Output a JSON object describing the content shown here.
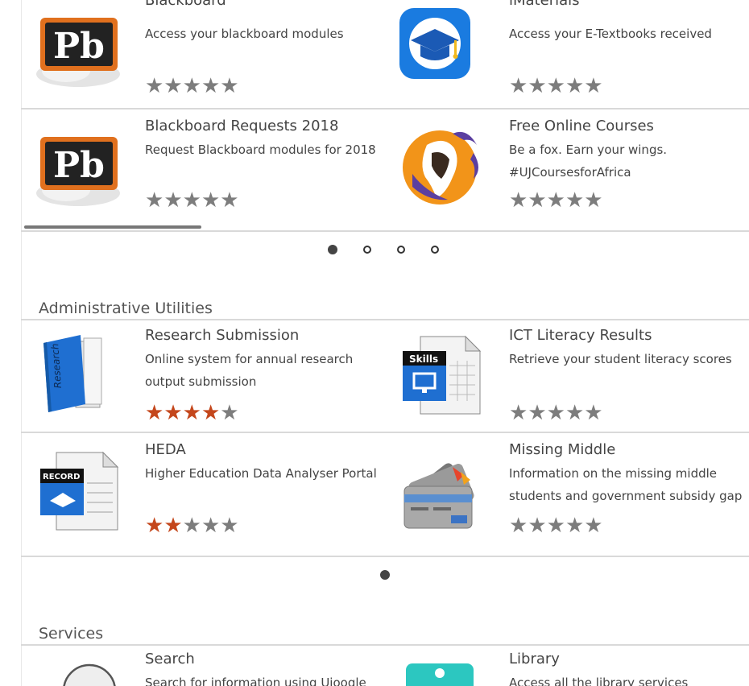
{
  "carousel1": {
    "cards": [
      {
        "title": "Blackboard",
        "desc": "Access your blackboard modules",
        "rating": 0,
        "icon": "blackboard-icon"
      },
      {
        "title": "iMaterials",
        "desc": "Access your E-Textbooks received",
        "rating": 0,
        "icon": "graduation-cap-icon"
      },
      {
        "title": "Blackboard Requests 2018",
        "desc": "Request Blackboard modules for 2018",
        "rating": 0,
        "icon": "blackboard-icon"
      },
      {
        "title": "Free Online Courses",
        "desc": "Be a fox. Earn your wings. #UJCoursesforAfrica",
        "rating": 0,
        "icon": "fox-africa-icon"
      }
    ],
    "pages": 4,
    "active_page": 1
  },
  "admin_section": {
    "title": "Administrative Utilities",
    "cards": [
      {
        "title": "Research Submission",
        "desc": "Online system for annual research output submission",
        "rating": 4,
        "icon": "research-folder-icon",
        "icon_label": "Research"
      },
      {
        "title": "ICT Literacy Results",
        "desc": "Retrieve your student literacy scores",
        "rating": 0,
        "icon": "skills-document-icon",
        "icon_label": "Skills"
      },
      {
        "title": "HEDA",
        "desc": "Higher Education Data Analyser Portal",
        "rating": 2,
        "icon": "record-document-icon",
        "icon_label": "RECORD"
      },
      {
        "title": "Missing Middle",
        "desc": "Information on the missing middle students and government subsidy gap",
        "rating": 0,
        "icon": "credit-cards-icon"
      }
    ],
    "pages": 1,
    "active_page": 1
  },
  "services_section": {
    "title": "Services",
    "cards": [
      {
        "title": "Search",
        "desc": "Search for information using Ujoogle",
        "icon": "search-circle-icon"
      },
      {
        "title": "Library",
        "desc": "Access all the library services",
        "icon": "library-icon"
      }
    ]
  },
  "colors": {
    "star_on": "#c4471c",
    "star_off": "#7d7d7d",
    "divider": "#d9d9d9"
  }
}
